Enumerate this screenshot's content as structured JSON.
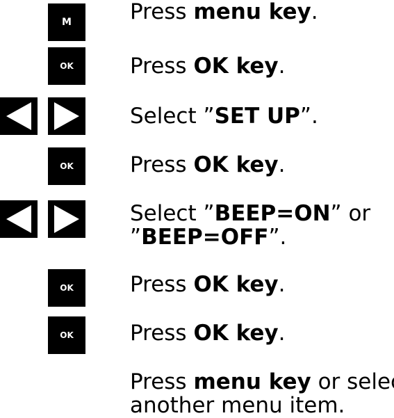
{
  "keys": {
    "menu": "M",
    "ok": "OK"
  },
  "steps": [
    {
      "pre": "Press ",
      "bold": "menu key",
      "post": "."
    },
    {
      "pre": "Press ",
      "bold": "OK key",
      "post": "."
    },
    {
      "pre": "Select ”",
      "bold": "SET UP",
      "post": "”."
    },
    {
      "pre": "Press ",
      "bold": "OK key",
      "post": "."
    },
    {
      "pre": "Select ”",
      "bold": "BEEP=ON",
      "mid": "” or",
      "pre2": "”",
      "bold2": "BEEP=OFF",
      "post2": "”."
    },
    {
      "pre": "Press ",
      "bold": "OK key",
      "post": "."
    },
    {
      "pre": "Press ",
      "bold": "OK key",
      "post": "."
    },
    {
      "pre": "Press ",
      "bold": "menu key",
      "mid": " or select",
      "line2": "another menu item."
    }
  ]
}
